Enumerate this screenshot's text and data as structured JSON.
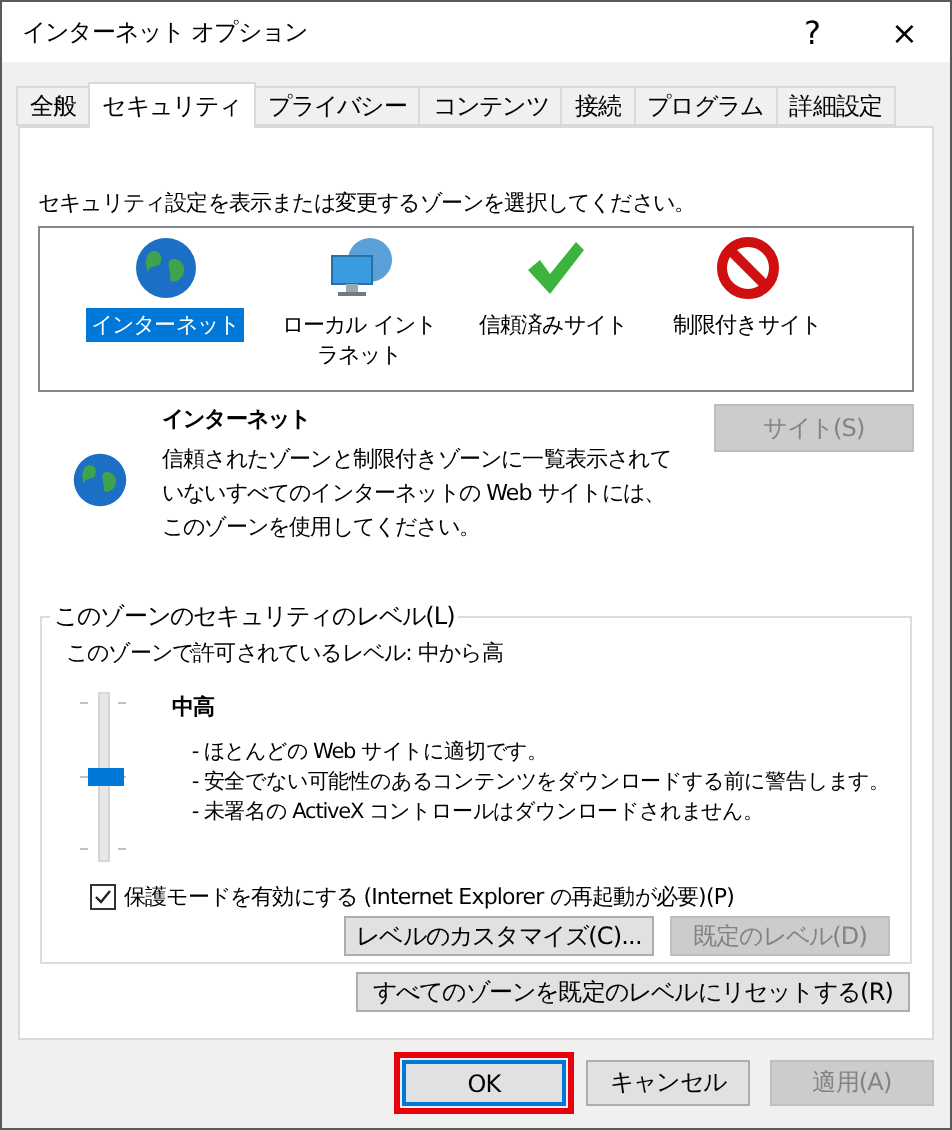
{
  "window": {
    "title": "インターネット オプション",
    "help": "?",
    "close": "×"
  },
  "tabs": [
    {
      "label": "全般",
      "selected": false
    },
    {
      "label": "セキュリティ",
      "selected": true
    },
    {
      "label": "プライバシー",
      "selected": false
    },
    {
      "label": "コンテンツ",
      "selected": false
    },
    {
      "label": "接続",
      "selected": false
    },
    {
      "label": "プログラム",
      "selected": false
    },
    {
      "label": "詳細設定",
      "selected": false
    }
  ],
  "zone_prompt": "セキュリティ設定を表示または変更するゾーンを選択してください。",
  "zones": [
    {
      "label": "インターネット",
      "kind": "globe",
      "selected": true
    },
    {
      "label": "ローカル イントラネット",
      "kind": "intranet",
      "selected": false
    },
    {
      "label": "信頼済みサイト",
      "kind": "trusted",
      "selected": false
    },
    {
      "label": "制限付きサイト",
      "kind": "restricted",
      "selected": false
    }
  ],
  "zone_info": {
    "name": "インターネット",
    "description": "信頼されたゾーンと制限付きゾーンに一覧表示されていないすべてのインターネットの Web サイトには、このゾーンを使用してください。",
    "sites_button": {
      "label": "サイト(S)",
      "disabled": true
    }
  },
  "level_group": {
    "legend": "このゾーンのセキュリティのレベル(L)",
    "allowed": "このゾーンで許可されているレベル: 中から高",
    "slider": {
      "level": 0.5
    },
    "level_name": "中高",
    "points": [
      "- ほとんどの Web サイトに適切です。",
      "- 安全でない可能性のあるコンテンツをダウンロードする前に警告します。",
      "- 未署名の ActiveX コントロールはダウンロードされません。"
    ],
    "protected_mode": {
      "label": "保護モードを有効にする (Internet Explorer の再起動が必要)(P)",
      "checked": true
    },
    "buttons": [
      {
        "label": "レベルのカスタマイズ(C)...",
        "disabled": false
      },
      {
        "label": "既定のレベル(D)",
        "disabled": true
      }
    ]
  },
  "reset_button": {
    "label": "すべてのゾーンを既定のレベルにリセットする(R)",
    "disabled": false
  },
  "dialog_buttons": [
    {
      "label": "OK",
      "disabled": false,
      "highlighted": true
    },
    {
      "label": "キャンセル",
      "disabled": false,
      "highlighted": false
    },
    {
      "label": "適用(A)",
      "disabled": true,
      "highlighted": false
    }
  ]
}
